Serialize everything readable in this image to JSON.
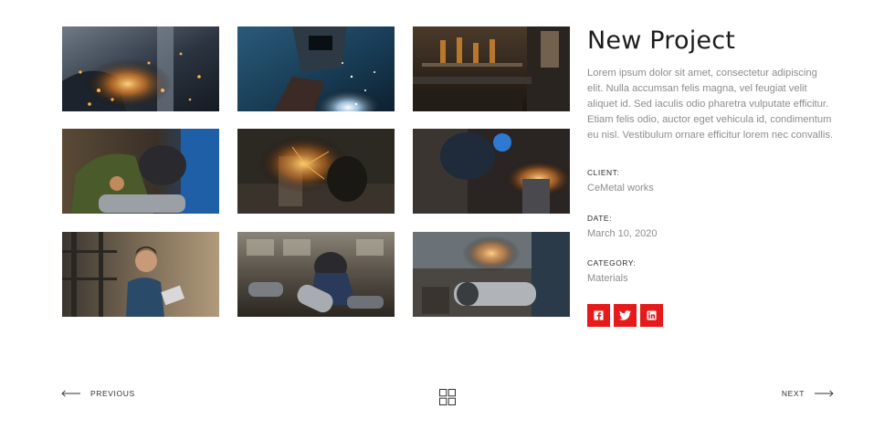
{
  "gallery": {
    "images": [
      {
        "alt": "grinder-sparks"
      },
      {
        "alt": "welder-mask-sparks"
      },
      {
        "alt": "factory-hall"
      },
      {
        "alt": "welder-pipe"
      },
      {
        "alt": "metal-workshop-sparks"
      },
      {
        "alt": "grinding-metal"
      },
      {
        "alt": "woman-with-tablet"
      },
      {
        "alt": "welder-pipes-floor"
      },
      {
        "alt": "pipe-cutting-sparks"
      }
    ]
  },
  "project": {
    "title": "New Project",
    "description": "Lorem ipsum dolor sit amet, consectetur adipiscing elit. Nulla accumsan felis magna, vel feugiat velit aliquet id. Sed iaculis odio pharetra vulputate efficitur.  Etiam felis odio, auctor eget vehicula id, condimentum eu nisl. Vestibulum ornare efficitur lorem nec convallis.",
    "client_label": "CLIENT:",
    "client_value": "CeMetal works",
    "date_label": "DATE:",
    "date_value": "March 10, 2020",
    "category_label": "CATEGORY:",
    "category_value": "Materials"
  },
  "social": {
    "accent": "#e51a1a",
    "icons": [
      "facebook-icon",
      "twitter-icon",
      "linkedin-icon"
    ]
  },
  "navigation": {
    "previous_label": "PREVIOUS",
    "next_label": "NEXT",
    "grid_icon": "grid-icon"
  }
}
